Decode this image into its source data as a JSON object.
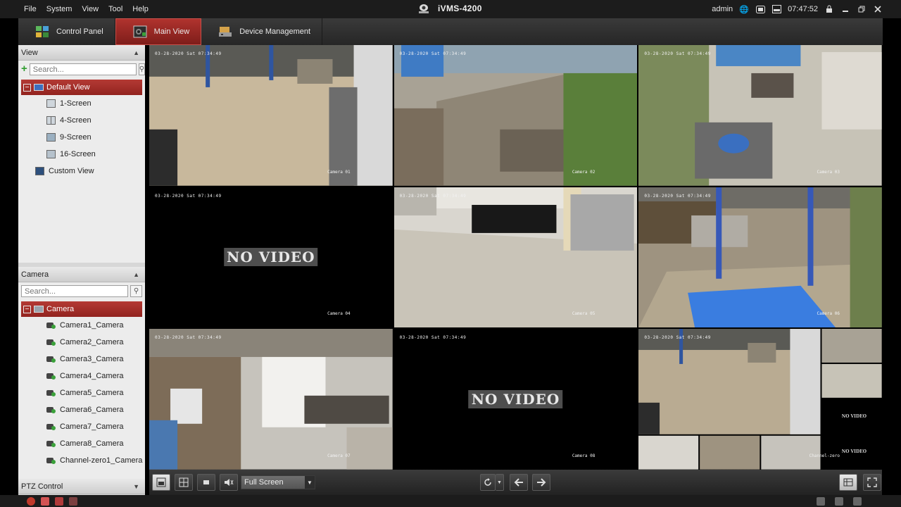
{
  "menubar": {
    "items": [
      "File",
      "System",
      "View",
      "Tool",
      "Help"
    ],
    "app_title": "iVMS-4200",
    "user": "admin",
    "clock": "07:47:52",
    "icons": [
      "globe-icon",
      "keyboard-icon",
      "ram-icon",
      "lock-icon",
      "minimize-icon",
      "restore-icon",
      "close-icon"
    ]
  },
  "tabs": [
    {
      "label": "Control Panel",
      "icon": "control-panel-icon",
      "active": false
    },
    {
      "label": "Main View",
      "icon": "main-view-icon",
      "active": true
    },
    {
      "label": "Device Management",
      "icon": "device-management-icon",
      "active": false
    }
  ],
  "view_section": {
    "title": "View",
    "search_placeholder": "Search...",
    "root": "Default View",
    "items": [
      "1-Screen",
      "4-Screen",
      "9-Screen",
      "16-Screen"
    ],
    "custom": "Custom View"
  },
  "camera_section": {
    "title": "Camera",
    "search_placeholder": "Search...",
    "root": "Camera",
    "items": [
      "Camera1_Camera",
      "Camera2_Camera",
      "Camera3_Camera",
      "Camera4_Camera",
      "Camera5_Camera",
      "Camera6_Camera",
      "Camera7_Camera",
      "Camera8_Camera",
      "Channel-zero1_Camera"
    ]
  },
  "ptz": {
    "title": "PTZ Control"
  },
  "video": {
    "no_video": "NO VIDEO",
    "osd_time": "03-28-2020 Sat 07:34:49",
    "cells": [
      {
        "name": "Camera 01",
        "status": "live"
      },
      {
        "name": "Camera 02",
        "status": "live"
      },
      {
        "name": "Camera 03",
        "status": "live"
      },
      {
        "name": "Camera 04",
        "status": "no-video"
      },
      {
        "name": "Camera 05",
        "status": "live"
      },
      {
        "name": "Camera 06",
        "status": "live"
      },
      {
        "name": "Camera 07",
        "status": "live"
      },
      {
        "name": "Camera 08",
        "status": "no-video"
      },
      {
        "name": "Channel-zero",
        "status": "live"
      }
    ],
    "mini_no_video": "NO VIDEO"
  },
  "toolbar": {
    "screen_mode": "Full Screen"
  },
  "colors": {
    "accent": "#a8302b",
    "panel_bg": "#ececec",
    "chrome": "#262626"
  }
}
